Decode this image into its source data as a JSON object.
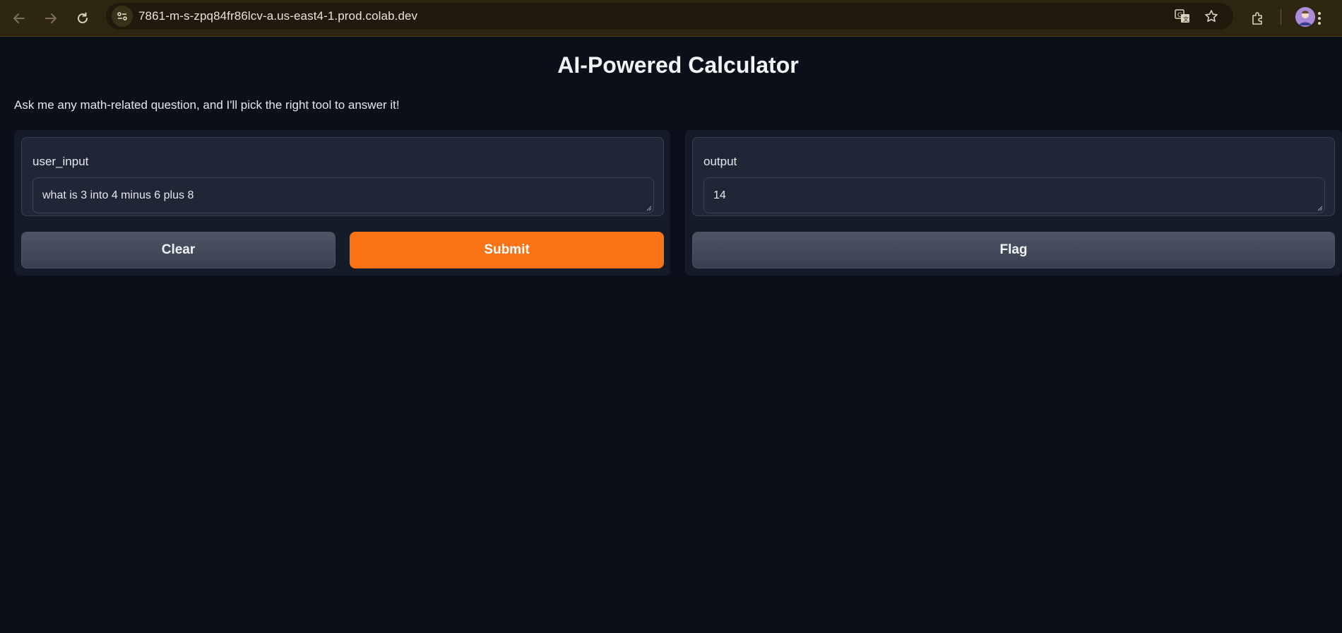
{
  "browser": {
    "url": "7861-m-s-zpq84fr86lcv-a.us-east4-1.prod.colab.dev",
    "icons": [
      "back-icon",
      "forward-icon",
      "reload-icon",
      "site-info-icon",
      "translate-icon",
      "bookmark-star-icon",
      "extensions-icon",
      "avatar",
      "menu-icon"
    ]
  },
  "app": {
    "title": "AI-Powered Calculator",
    "description": "Ask me any math-related question, and I'll pick the right tool to answer it!"
  },
  "input_panel": {
    "label": "user_input",
    "value": "what is 3 into 4 minus 6 plus 8",
    "clear_label": "Clear",
    "submit_label": "Submit"
  },
  "output_panel": {
    "label": "output",
    "value": "14",
    "flag_label": "Flag"
  },
  "colors": {
    "background": "#0b0f19",
    "panel": "#151b29",
    "field": "#1f2737",
    "accent": "#f97316",
    "secondary_button": "#4b5563",
    "browser_bar": "#2e2610"
  }
}
